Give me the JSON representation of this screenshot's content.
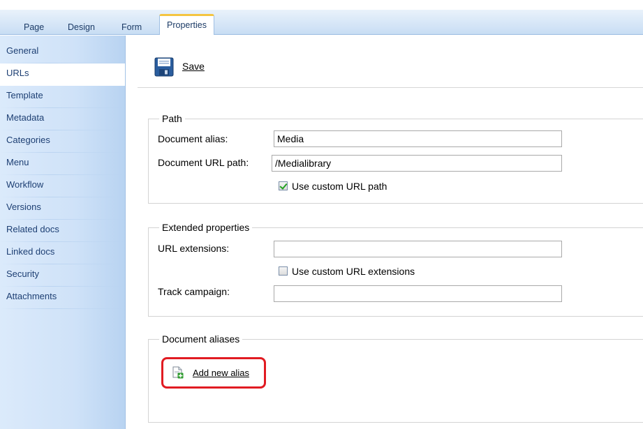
{
  "tabs": [
    {
      "label": "Page"
    },
    {
      "label": "Design"
    },
    {
      "label": "Form"
    },
    {
      "label": "Properties",
      "active": true
    }
  ],
  "sidebar": {
    "items": [
      {
        "label": "General"
      },
      {
        "label": "URLs",
        "selected": true
      },
      {
        "label": "Template"
      },
      {
        "label": "Metadata"
      },
      {
        "label": "Categories"
      },
      {
        "label": "Menu"
      },
      {
        "label": "Workflow"
      },
      {
        "label": "Versions"
      },
      {
        "label": "Related docs"
      },
      {
        "label": "Linked docs"
      },
      {
        "label": "Security"
      },
      {
        "label": "Attachments"
      }
    ]
  },
  "toolbar": {
    "save_label": "Save",
    "save_icon": "floppy-disk-icon"
  },
  "path": {
    "legend": "Path",
    "alias_label": "Document alias:",
    "alias_value": "Media",
    "url_path_label": "Document URL path:",
    "url_path_value": "/Medialibrary",
    "custom_url_label": "Use custom URL path",
    "custom_url_checked": true
  },
  "extended": {
    "legend": "Extended properties",
    "url_ext_label": "URL extensions:",
    "url_ext_value": "",
    "custom_ext_label": "Use custom URL extensions",
    "custom_ext_checked": false,
    "track_label": "Track campaign:",
    "track_value": ""
  },
  "aliases": {
    "legend": "Document aliases",
    "add_label": "Add new alias",
    "add_icon": "add-document-icon"
  },
  "colors": {
    "accent_tab": "#f4c542",
    "highlight": "#e11b22",
    "sidebar_text": "#1d3f73"
  }
}
